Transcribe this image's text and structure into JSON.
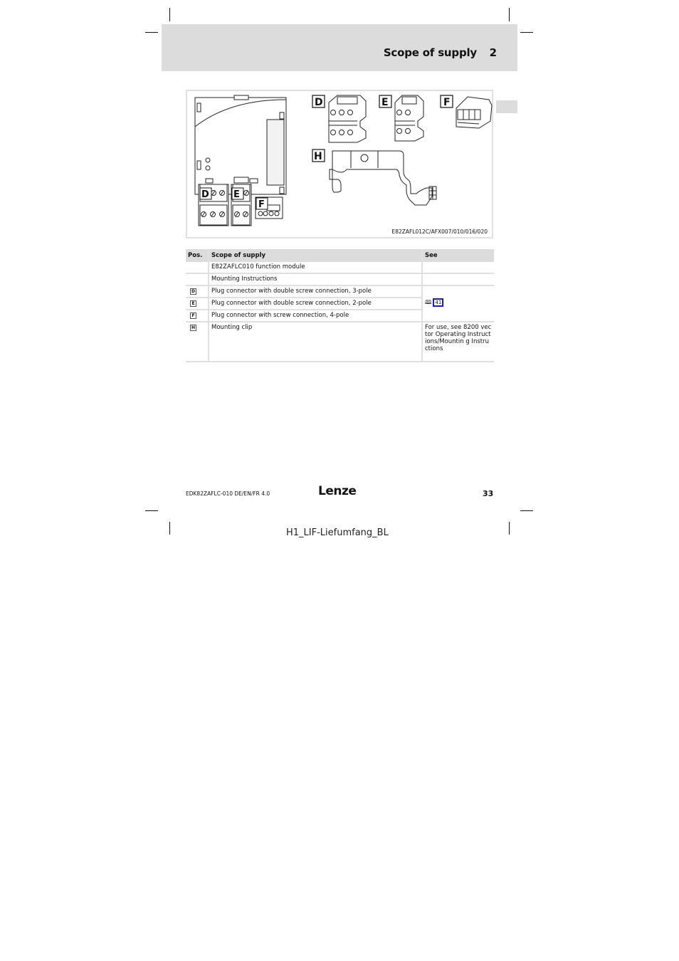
{
  "header": {
    "title": "Scope of supply",
    "chapter": "2"
  },
  "figure": {
    "caption": "E82ZAFL012C/AFX007/010/016/020",
    "labels": {
      "d": "D",
      "e": "E",
      "f": "F",
      "h": "H"
    }
  },
  "table": {
    "headers": {
      "pos": "Pos.",
      "scope": "Scope of supply",
      "see": "See"
    },
    "rows": [
      {
        "pos": "",
        "scope": "E82ZAFLC010 function module",
        "see": ""
      },
      {
        "pos": "",
        "scope": "Mounting Instructions",
        "see": ""
      },
      {
        "pos": "D",
        "scope": "Plug connector with double screw connection, 3-pole"
      },
      {
        "pos": "E",
        "scope": "Plug connector with double screw connection, 2-pole"
      },
      {
        "pos": "F",
        "scope": "Plug connector with screw connection, 4-pole"
      },
      {
        "pos": "H",
        "scope": "Mounting clip",
        "see": "For use, see 8200 vector Operating Instructions/Mountin g Instructions"
      }
    ],
    "connectors_see": {
      "icon": "book-icon",
      "page_ref": "41"
    }
  },
  "footer": {
    "doc_id": "EDK82ZAFLC-010  DE/EN/FR  4.0",
    "logo": "Lenze",
    "page_number": "33"
  },
  "slug": "H1_LIF-Liefumfang_BL"
}
